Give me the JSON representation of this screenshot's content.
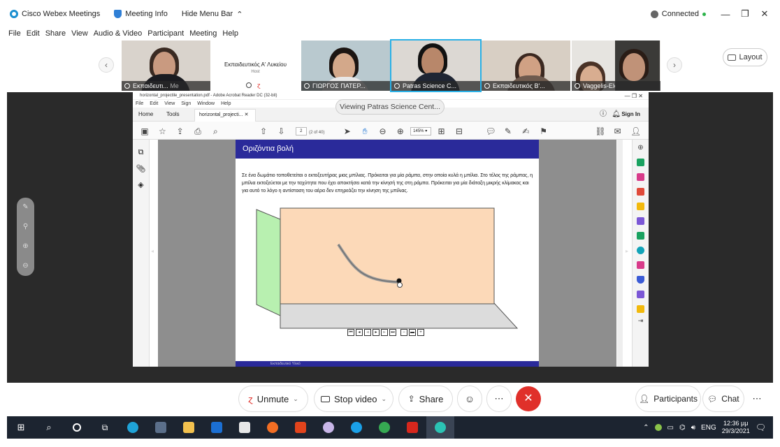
{
  "titlebar": {
    "app_name": "Cisco Webex Meetings",
    "meeting_info": "Meeting Info",
    "hide_menu_bar": "Hide Menu Bar",
    "status": "Connected"
  },
  "menu": [
    "File",
    "Edit",
    "Share",
    "View",
    "Audio & Video",
    "Participant",
    "Meeting",
    "Help"
  ],
  "participants_strip": [
    {
      "name": "Εκπαιδευτι...",
      "extra": "Me"
    },
    {
      "name": "Εκπαιδευτικός Α' Λυκείου",
      "role": "Host"
    },
    {
      "name": "ΓΙΩΡΓΟΣ ΠΑΤΕΡ..."
    },
    {
      "name": "Patras Science C..."
    },
    {
      "name": "Εκπαιδευτικός Β'..."
    },
    {
      "name": "Vaggelis-Eleni"
    },
    {
      "name": ""
    }
  ],
  "layout_button": "Layout",
  "shared": {
    "viewing_label": "Viewing Patras Science Cent...",
    "acrobat_title": "horizontal_projectile_presentation.pdf - Adobe Acrobat Reader DC (32-bit)",
    "acrobat_menu": [
      "File",
      "Edit",
      "View",
      "Sign",
      "Window",
      "Help"
    ],
    "tabs": [
      "Home",
      "Tools",
      "horizontal_projecti..."
    ],
    "sign_in": "Sign In",
    "page_current": "2",
    "page_total": "(2 of 40)",
    "zoom": "145%",
    "slide_title": "Οριζόντια βολή",
    "slide_text": "Σε ένα δωμάτιο τοποθετείται ο εκτοξευτήρας μιας μπίλιας. Πρόκειται για μία ράμπα, στην οποία κυλά η μπίλια. Στο τέλος της ράμπας, η μπίλια εκτοξεύεται με την ταχύτητα που έχει αποκτήσει κατά την κίνησή της στη ράμπα. Πρόκειται για μία διάταξη μικρής κλίμακας και για αυτό το λόγο η αντίσταση του αέρα δεν επηρεάζει την κίνηση της μπίλιας.",
    "slide_footer": "Εκπαιδευτικό Υλικό"
  },
  "bottom_controls": {
    "unmute": "Unmute",
    "stop_video": "Stop video",
    "share": "Share",
    "participants": "Participants",
    "chat": "Chat"
  },
  "taskbar": {
    "lang": "ENG",
    "time": "12:36 μμ",
    "date": "29/3/2021"
  },
  "colors": {
    "webex_red": "#e0302a",
    "slide_blue": "#2a2a9a",
    "wall_peach": "#fcd9b8",
    "wall_green": "#b8f0b0",
    "floor_gray": "#dcdcdc"
  }
}
